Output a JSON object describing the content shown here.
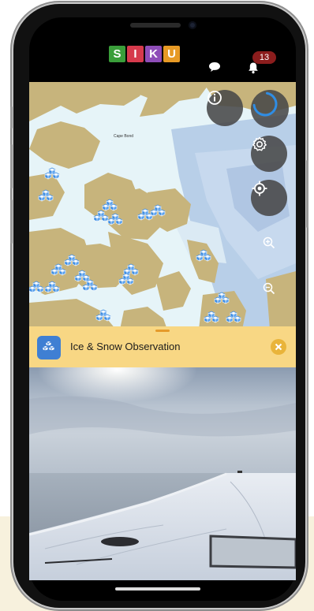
{
  "header": {
    "logo_letters": [
      {
        "letter": "S",
        "color": "#3a9e3a"
      },
      {
        "letter": "I",
        "color": "#d63a4c"
      },
      {
        "letter": "K",
        "color": "#8e4db8"
      },
      {
        "letter": "U",
        "color": "#e79a25"
      }
    ],
    "chat_icon": "chat-bubble-icon",
    "bell_icon": "bell-icon",
    "notification_count": "13"
  },
  "map": {
    "place_label": "Cape Bond",
    "observation_marker_icon": "ice-blocks-icon",
    "controls": [
      {
        "name": "info-button",
        "icon": "info-icon"
      },
      {
        "name": "loading-button",
        "icon": "spinner-icon",
        "accent": "#2f8de4"
      },
      {
        "name": "settings-button",
        "icon": "gear-icon"
      },
      {
        "name": "locate-button",
        "icon": "crosshair-icon"
      },
      {
        "name": "zoom-in-button",
        "icon": "zoom-in-icon"
      },
      {
        "name": "zoom-out-button",
        "icon": "zoom-out-icon"
      }
    ],
    "colors": {
      "land": "#c7b47c",
      "sea_ice": "#e7f4f8",
      "open_water": "#aec6e4",
      "marker": "#3f8ee3"
    }
  },
  "card": {
    "title": "Ice & Snow Observation",
    "icon": "ice-blocks-icon",
    "close_icon": "close-icon",
    "background": "#f8d784"
  },
  "photo": {
    "description_icon": "landscape-photo"
  }
}
